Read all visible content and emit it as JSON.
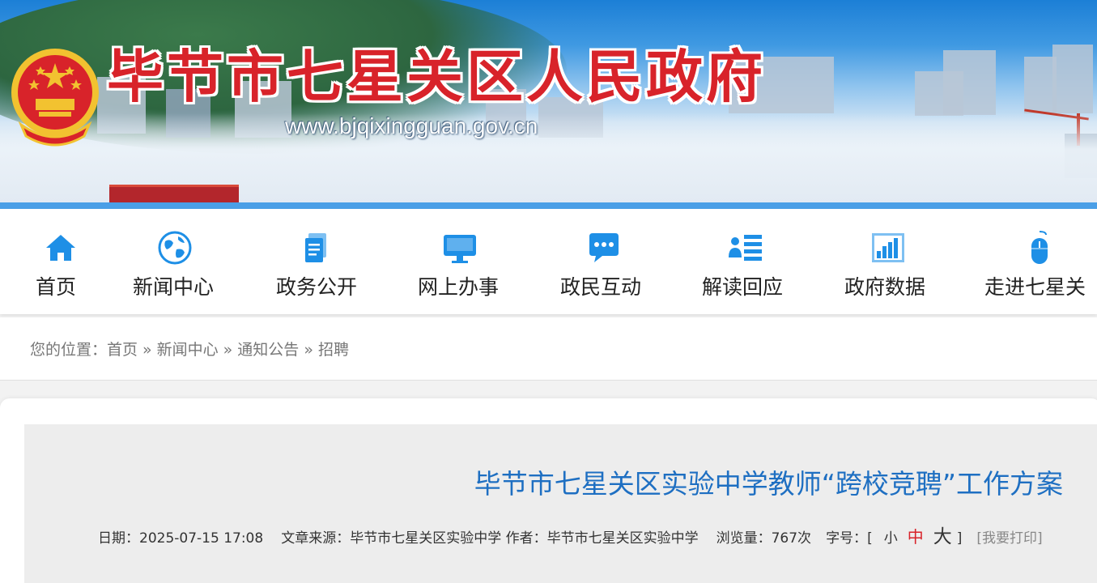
{
  "header": {
    "site_title": "毕节市七星关区人民政府",
    "site_url": "www.bjqixingguan.gov.cn",
    "emblem_icon": "national-emblem-icon"
  },
  "nav": {
    "items": [
      {
        "label": "首页",
        "icon": "home-icon"
      },
      {
        "label": "新闻中心",
        "icon": "globe-icon"
      },
      {
        "label": "政务公开",
        "icon": "document-icon"
      },
      {
        "label": "网上办事",
        "icon": "monitor-icon"
      },
      {
        "label": "政民互动",
        "icon": "chat-bubble-icon"
      },
      {
        "label": "解读回应",
        "icon": "user-list-icon"
      },
      {
        "label": "政府数据",
        "icon": "bar-chart-icon"
      },
      {
        "label": "走进七星关",
        "icon": "mouse-icon"
      }
    ],
    "icon_color": "#1e8fe6"
  },
  "breadcrumb": {
    "prefix": "您的位置：",
    "items": [
      "首页",
      "新闻中心",
      "通知公告",
      "招聘"
    ],
    "separator": "»"
  },
  "article": {
    "title": "毕节市七星关区实验中学教师“跨校竞聘”工作方案",
    "date_label": "日期：",
    "date": "2025-07-15 17:08",
    "source_label": "文章来源：",
    "source": "毕节市七星关区实验中学",
    "author_label": "作者：",
    "author": "毕节市七星关区实验中学",
    "views_label": "浏览量：",
    "views": "767次",
    "fontsize_label": "字号：",
    "bracket_open": "[",
    "bracket_close": "]",
    "size_small": "小",
    "size_mid": "中",
    "size_big": "大",
    "print": "[我要打印]"
  },
  "colors": {
    "title_red": "#d8232a",
    "accent_blue": "#1e6fc2",
    "bar_blue": "#4a9fe7"
  }
}
